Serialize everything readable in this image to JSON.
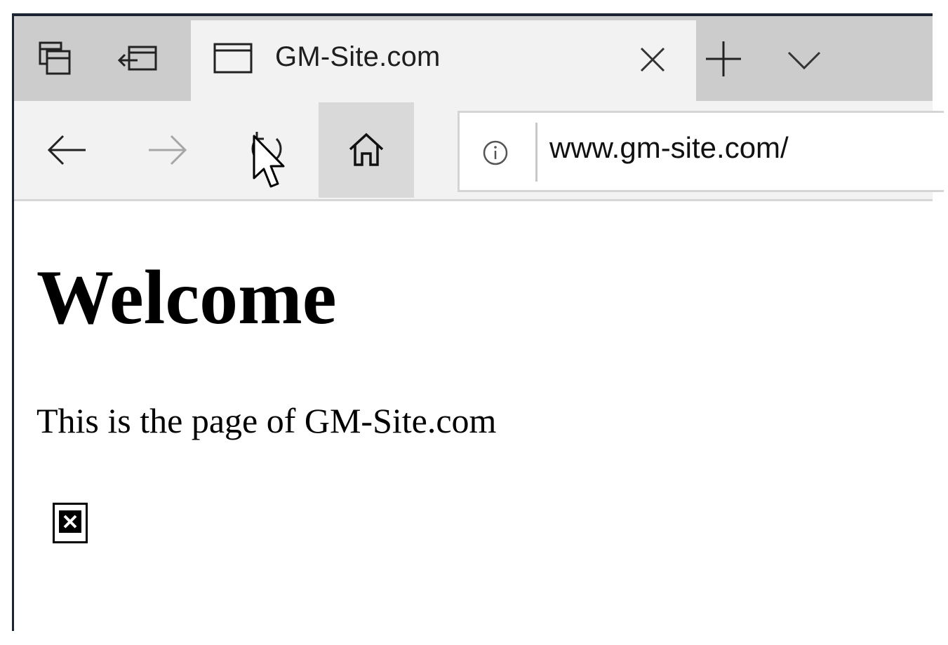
{
  "browser": {
    "tab": {
      "title": "GM-Site.com"
    },
    "address_bar": {
      "url": "www.gm-site.com/"
    },
    "icons": {
      "tab_sets": "tab-sets-icon",
      "set_tabs_aside": "set-tabs-aside-icon",
      "page": "page-icon",
      "close": "close-icon",
      "new_tab": "plus-icon",
      "tab_menu": "chevron-down-icon",
      "back": "back-arrow-icon",
      "forward": "forward-arrow-icon",
      "refresh": "refresh-icon",
      "home": "home-icon",
      "site_info": "info-icon",
      "cursor": "mouse-cursor-icon"
    },
    "colors": {
      "tabstrip": "#cccccc",
      "active_tab": "#f2f2f2",
      "home_highlight": "#d9d9d9"
    }
  },
  "page": {
    "heading": "Welcome",
    "text": "This is the page of GM-Site.com",
    "image_state": "broken-image-icon"
  }
}
